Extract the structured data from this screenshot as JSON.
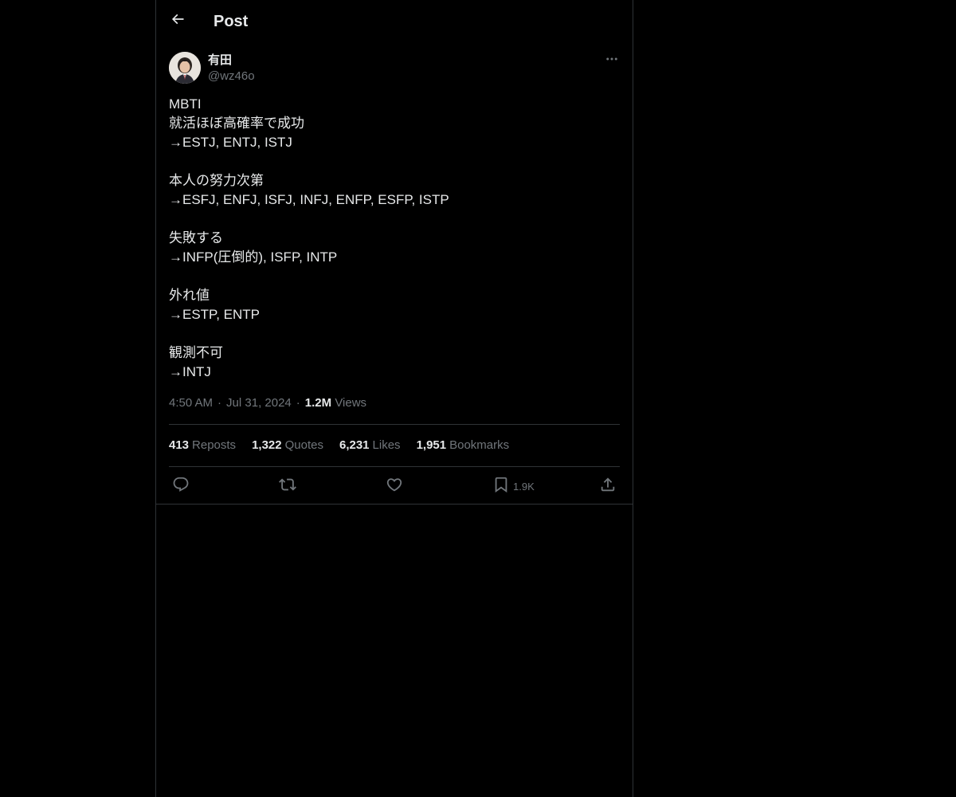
{
  "header": {
    "title": "Post"
  },
  "author": {
    "display_name": "有田",
    "handle": "@wz46o"
  },
  "tweet": {
    "lines": [
      "MBTI",
      "就活ほぼ高確率で成功",
      "→ESTJ, ENTJ, ISTJ",
      "",
      "本人の努力次第",
      "→ESFJ, ENFJ, ISFJ, INFJ, ENFP, ESFP, ISTP",
      "",
      "失敗する",
      "→INFP(圧倒的), ISFP, INTP",
      "",
      "外れ値",
      "→ESTP, ENTP",
      "",
      "観測不可",
      "→INTJ"
    ]
  },
  "meta": {
    "time": "4:50 AM",
    "separator": "·",
    "date": "Jul 31, 2024",
    "views_count": "1.2M",
    "views_label": "Views"
  },
  "stats": {
    "reposts_count": "413",
    "reposts_label": "Reposts",
    "quotes_count": "1,322",
    "quotes_label": "Quotes",
    "likes_count": "6,231",
    "likes_label": "Likes",
    "bookmarks_count": "1,951",
    "bookmarks_label": "Bookmarks"
  },
  "actions": {
    "bookmark_count": "1.9K"
  },
  "colors": {
    "background": "#000000",
    "text": "#e7e9ea",
    "secondary": "#71767b",
    "border": "#2f3336"
  },
  "icons": {
    "back": "arrow-left-icon",
    "more": "more-horizontal-icon",
    "reply": "reply-icon",
    "retweet": "retweet-icon",
    "like": "heart-icon",
    "bookmark": "bookmark-icon",
    "share": "share-icon"
  }
}
